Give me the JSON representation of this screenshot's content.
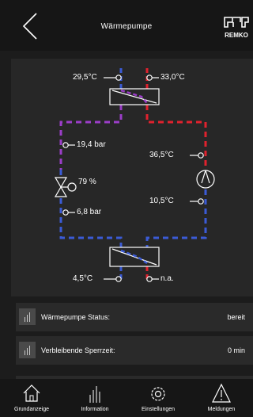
{
  "header": {
    "title": "Wärmepumpe",
    "logo_text": "REMKO"
  },
  "diagram": {
    "temp_top_left": "29,5°C",
    "temp_top_right": "33,0°C",
    "pressure_high": "19,4 bar",
    "valve_opening": "79 %",
    "pressure_low": "6,8 bar",
    "temp_right_upper": "36,5°C",
    "temp_right_lower": "10,5°C",
    "temp_bottom_left": "4,5°C",
    "temp_bottom_right": "n.a.",
    "colors": {
      "cold": "#3b5bd6",
      "hot": "#e0222e",
      "mixed": "#9b3ec8"
    }
  },
  "status": [
    {
      "label": "Wärmepumpe Status:",
      "value": "bereit"
    },
    {
      "label": "Verbleibende Sperrzeit:",
      "value": "0 min"
    }
  ],
  "nav": [
    {
      "label": "Grundanzeige",
      "icon": "home-icon"
    },
    {
      "label": "Information",
      "icon": "bars-icon"
    },
    {
      "label": "Einstellungen",
      "icon": "gear-icon"
    },
    {
      "label": "Meldungen",
      "icon": "warning-icon"
    }
  ]
}
